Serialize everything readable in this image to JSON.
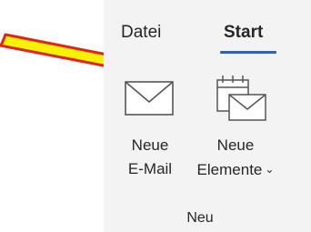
{
  "tabs": [
    {
      "label": "Datei"
    },
    {
      "label": "Start"
    }
  ],
  "commands": {
    "new_email": {
      "line1": "Neue",
      "line2": "E-Mail",
      "icon": "envelope-icon"
    },
    "new_items": {
      "line1": "Neue",
      "line2": "Elemente",
      "icon": "calendar-envelope-icon"
    }
  },
  "group": {
    "label": "Neu"
  },
  "colors": {
    "ribbon_bg": "#f3f3f3",
    "tab_underline": "#2b63b6",
    "arrow_fill": "#f7f300",
    "arrow_stroke": "#e2221c"
  }
}
